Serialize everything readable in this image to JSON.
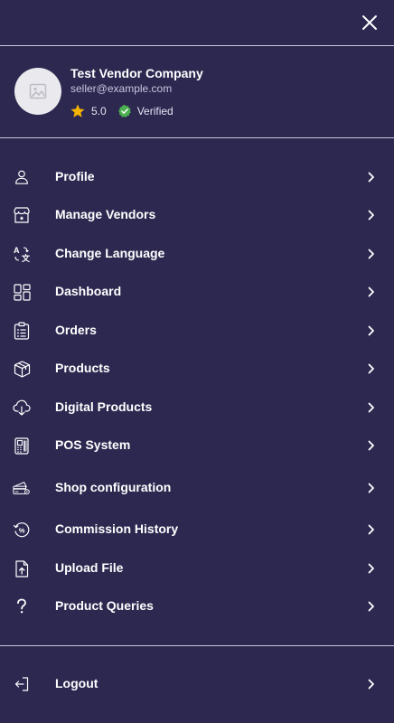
{
  "profile": {
    "company_name": "Test Vendor Company",
    "email": "seller@example.com",
    "rating": "5.0",
    "verified_label": "Verified"
  },
  "menu": {
    "items": [
      {
        "label": "Profile",
        "icon": "user-icon"
      },
      {
        "label": "Manage Vendors",
        "icon": "store-icon"
      },
      {
        "label": "Change Language",
        "icon": "translate-icon"
      },
      {
        "label": "Dashboard",
        "icon": "dashboard-icon"
      },
      {
        "label": "Orders",
        "icon": "clipboard-icon"
      },
      {
        "label": "Products",
        "icon": "box-icon"
      },
      {
        "label": "Digital Products",
        "icon": "cloud-download-icon"
      },
      {
        "label": "POS System",
        "icon": "pos-terminal-icon"
      },
      {
        "label": "Shop configuration",
        "icon": "card-settings-icon"
      },
      {
        "label": "Commission History",
        "icon": "commission-history-icon"
      },
      {
        "label": "Upload File",
        "icon": "file-upload-icon"
      },
      {
        "label": "Product Queries",
        "icon": "question-icon"
      }
    ],
    "logout_label": "Logout"
  },
  "colors": {
    "background": "#2d2850",
    "star": "#f5b400",
    "verified": "#4caf50"
  }
}
